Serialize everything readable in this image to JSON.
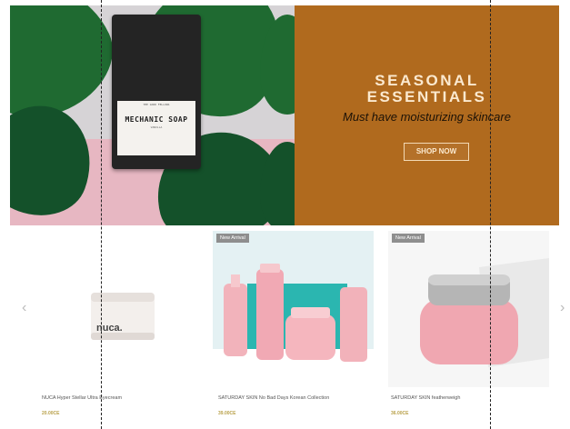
{
  "hero": {
    "soap_brand": "THE GOOD FELLOWS",
    "soap_name": "MECHANIC SOAP",
    "soap_sub": "VANILLA",
    "title_line1": "SEASONAL",
    "title_line2": "ESSENTIALS",
    "subtitle": "Must have moisturizing skincare",
    "cta_label": "SHOP NOW",
    "bg_color": "#b06a1e"
  },
  "carousel": {
    "prev_icon": "‹",
    "next_icon": "›",
    "products": [
      {
        "badge": "",
        "label_on_image": "nuca.",
        "name": "NUCA Hyper Stellar Ultra Eyecream",
        "price": "20.00CE"
      },
      {
        "badge": "New Arrival",
        "name": "SATURDAY SKIN No Bad Days Korean Collection",
        "price": "39.00CE"
      },
      {
        "badge": "New Arrival",
        "name": "SATURDAY SKIN featherweigh",
        "price": "36.00CE"
      }
    ]
  }
}
